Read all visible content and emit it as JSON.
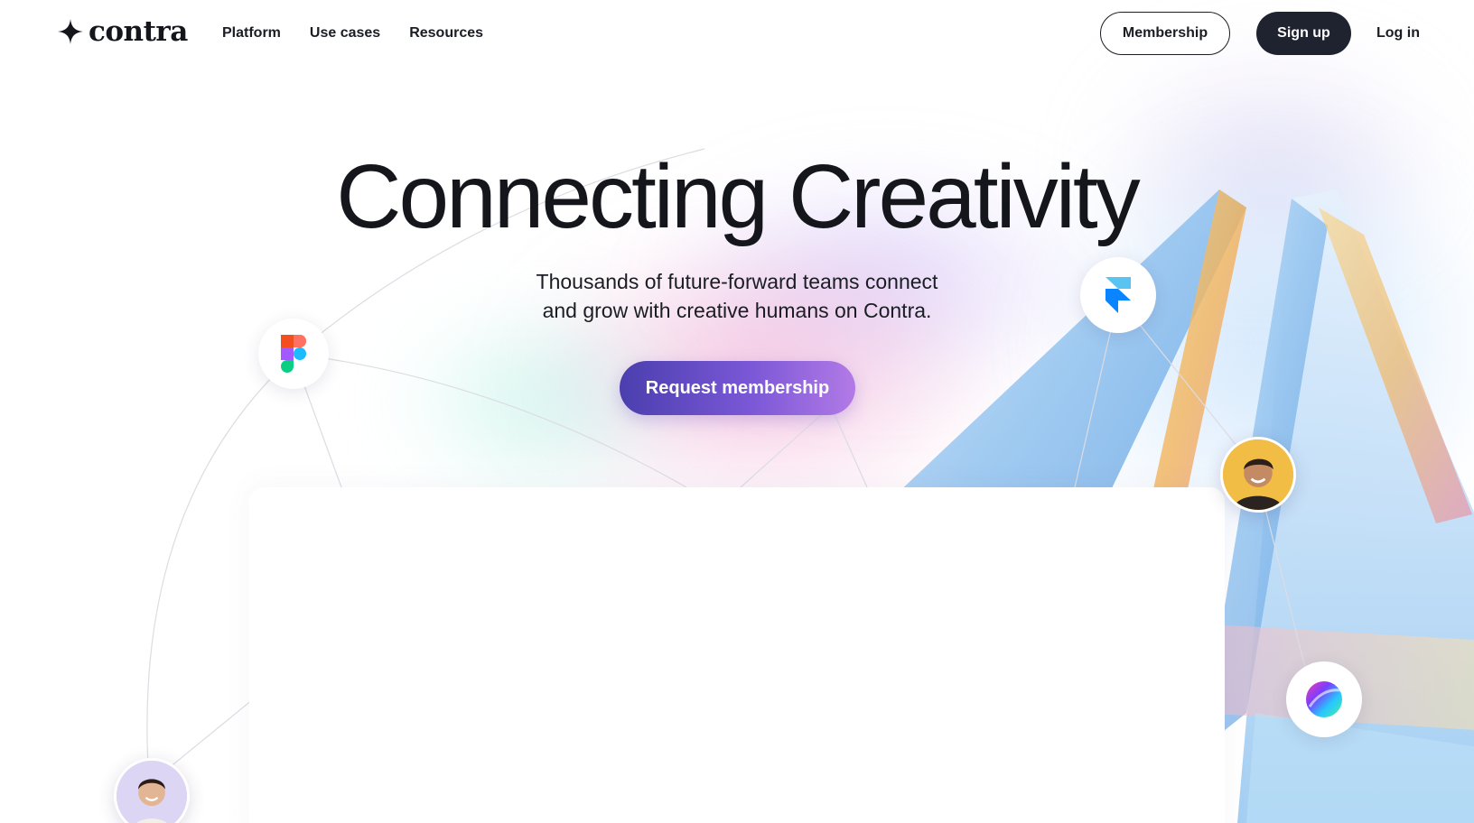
{
  "brand": {
    "name": "contra",
    "logo_icon": "four-point-star-icon"
  },
  "nav": {
    "items": [
      {
        "label": "Platform"
      },
      {
        "label": "Use cases"
      },
      {
        "label": "Resources"
      }
    ]
  },
  "actions": {
    "membership_label": "Membership",
    "signup_label": "Sign up",
    "login_label": "Log in"
  },
  "hero": {
    "title": "Connecting Creativity",
    "subtitle_line1": "Thousands of future-forward teams connect",
    "subtitle_line2": "and grow with creative humans on Contra.",
    "cta_label": "Request membership"
  },
  "floating_nodes": [
    {
      "name": "figma-icon"
    },
    {
      "name": "framer-icon"
    },
    {
      "name": "gradient-orb-icon"
    },
    {
      "name": "avatar-man"
    },
    {
      "name": "avatar-woman"
    }
  ],
  "colors": {
    "ink": "#1b1d24",
    "signup_bg": "#1f2330",
    "cta_gradient_start": "#4a3fae",
    "cta_gradient_end": "#b27ae6"
  }
}
